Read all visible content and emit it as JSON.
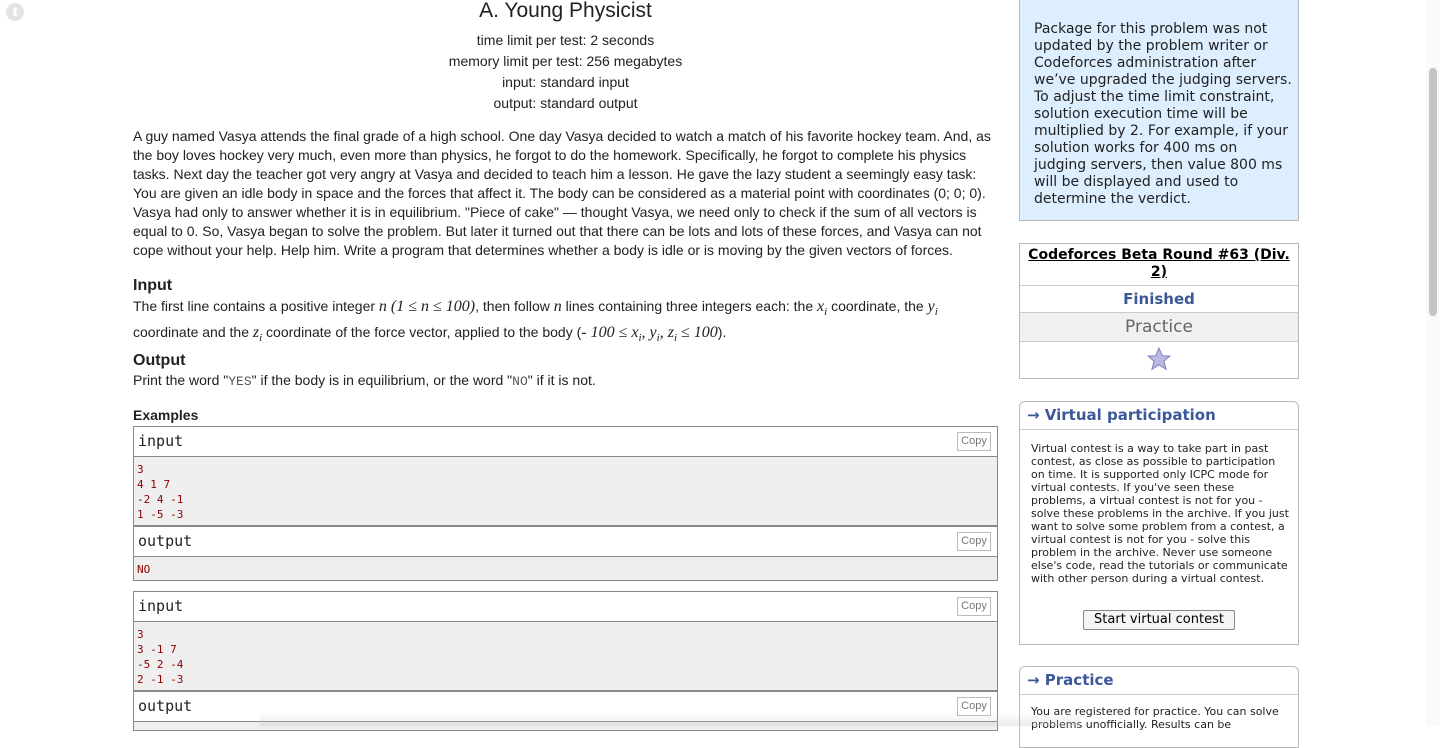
{
  "problem": {
    "title": "A. Young Physicist",
    "time_limit": "time limit per test: 2 seconds",
    "memory_limit": "memory limit per test: 256 megabytes",
    "input_file": "input: standard input",
    "output_file": "output: standard output",
    "legend": "A guy named Vasya attends the final grade of a high school. One day Vasya decided to watch a match of his favorite hockey team. And, as the boy loves hockey very much, even more than physics, he forgot to do the homework. Specifically, he forgot to complete his physics tasks. Next day the teacher got very angry at Vasya and decided to teach him a lesson. He gave the lazy student a seemingly easy task: You are given an idle body in space and the forces that affect it. The body can be considered as a material point with coordinates (0; 0; 0). Vasya had only to answer whether it is in equilibrium. \"Piece of cake\" — thought Vasya, we need only to check if the sum of all vectors is equal to 0. So, Vasya began to solve the problem. But later it turned out that there can be lots and lots of these forces, and Vasya can not cope without your help. Help him. Write a program that determines whether a body is idle or is moving by the given vectors of forces.",
    "input_title": "Input",
    "input_text": {
      "p1": "The first line contains a positive integer ",
      "m1": "n (1 ≤ n ≤ 100)",
      "p2": ", then follow ",
      "m2": "n",
      "p3": " lines containing three integers each: the ",
      "m3": "x",
      "m3sub": "i",
      "p4": " coordinate, the ",
      "m4": "y",
      "m4sub": "i",
      "p5": "coordinate and the ",
      "m5": "z",
      "m5sub": "i",
      "p6": " coordinate of the force vector, applied to the body (",
      "m6": "- 100 ≤ x",
      "m6sub1": "i",
      "m6b": ", y",
      "m6sub2": "i",
      "m6c": ", z",
      "m6sub3": "i",
      "m6d": " ≤ 100",
      "p7": ")."
    },
    "output_title": "Output",
    "output_text": {
      "p1": "Print the word \"",
      "yes": "YES",
      "p2": "\" if the body is in equilibrium, or the word \"",
      "no": "NO",
      "p3": "\" if it is not."
    },
    "examples_title": "Examples",
    "samples": [
      {
        "input_label": "input",
        "input": "3\n4 1 7\n-2 4 -1\n1 -5 -3",
        "output_label": "output",
        "output": "NO"
      },
      {
        "input_label": "input",
        "input": "3\n3 -1 7\n-5 2 -4\n2 -1 -3",
        "output_label": "output",
        "output": ""
      }
    ],
    "copy_label": "Copy"
  },
  "sidebar": {
    "notice": "Package for this problem was not updated by the problem writer or Codeforces administration after we’ve upgraded the judging servers. To adjust the time limit constraint, solution execution time will be multiplied by 2. For example, if your solution works for 400 ms on judging servers, then value 800 ms will be displayed and used to determine the verdict.",
    "contest_name": "Codeforces Beta Round #63 (Div. 2)",
    "contest_status": "Finished",
    "contest_mode": "Practice",
    "virtual_title": "→ Virtual participation",
    "virtual_text": "Virtual contest is a way to take part in past contest, as close as possible to participation on time. It is supported only ICPC mode for virtual contests. If you've seen these problems, a virtual contest is not for you - solve these problems in the archive. If you just want to solve some problem from a contest, a virtual contest is not for you - solve this problem in the archive. Never use someone else's code, read the tutorials or communicate with other person during a virtual contest.",
    "virtual_button": "Start virtual contest",
    "practice_title": "→ Practice",
    "practice_text": "You are registered for practice. You can solve problems unofficially. Results can be"
  },
  "icons": {
    "scroll_top": "arrow-up-icon",
    "favourite": "star-icon"
  },
  "colors": {
    "accent": "#3b5998",
    "notice_bg": "#ddeeff",
    "sample_text": "#8b0000"
  }
}
